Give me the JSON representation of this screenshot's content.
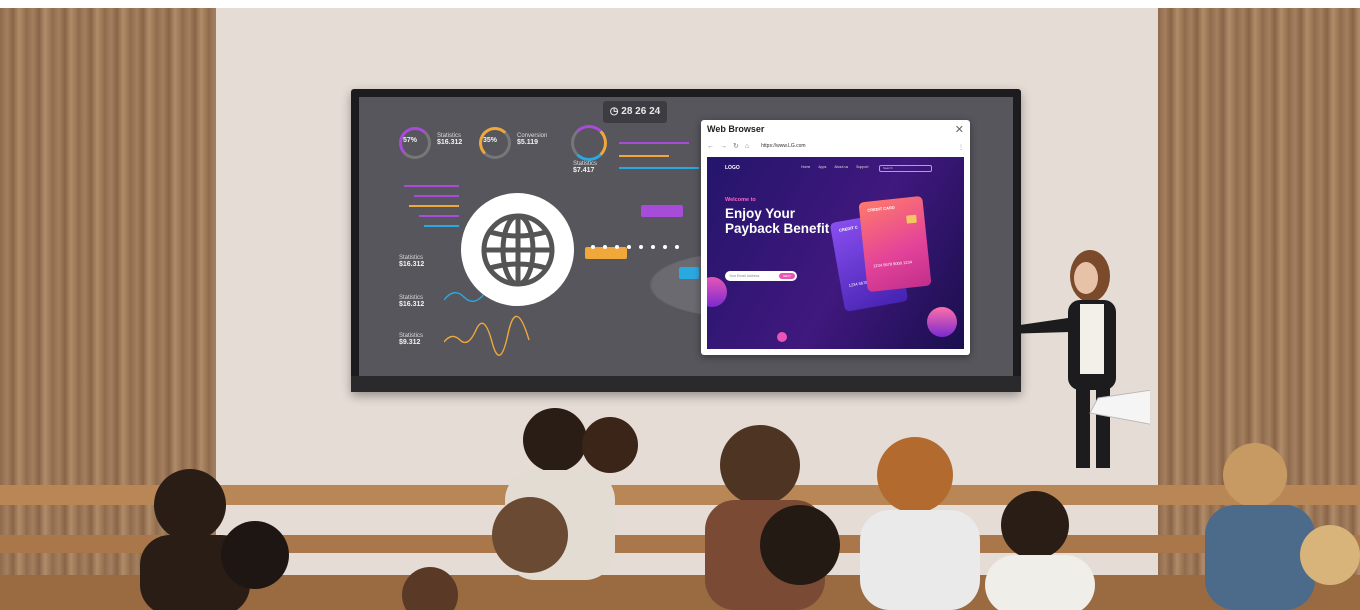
{
  "scene": {
    "display_clock": "28 26 24",
    "dashboard": {
      "stat1": {
        "percent": "57%",
        "label": "Statistics",
        "value": "$16.312"
      },
      "stat2": {
        "percent": "35%",
        "label": "Conversion",
        "value": "$5.119"
      },
      "stat3": {
        "label": "Statistics",
        "value": "$7.417"
      },
      "stat4": {
        "label": "Statistics",
        "value": "$16.312"
      },
      "stat5": {
        "label": "Statistics",
        "value": "$16.312"
      },
      "stat6": {
        "label": "Statistics",
        "value": "$9.312"
      }
    },
    "browser": {
      "title": "Web Browser",
      "close_glyph": "✕",
      "url": "https://www.LG.com",
      "page": {
        "logo": "LOGO",
        "nav_links": [
          "Home",
          "Apps",
          "About us",
          "Support"
        ],
        "search_placeholder": "Search",
        "welcome": "Welcome to",
        "headline": "Enjoy Your Payback Benefit",
        "email_placeholder": "Your Email Address",
        "cta": "NEXT",
        "card_front_label": "CREDIT CARD",
        "card_back_label": "CREDIT C",
        "card_front_number": "1234 5678 9000 1234",
        "card_back_number": "1234 5678 9000"
      }
    }
  },
  "colors": {
    "wall": "#e6dcd6",
    "wood": "#a3805f",
    "screen": "#56565c",
    "accent_pink": "#e855b6",
    "accent_purple": "#40187e"
  }
}
